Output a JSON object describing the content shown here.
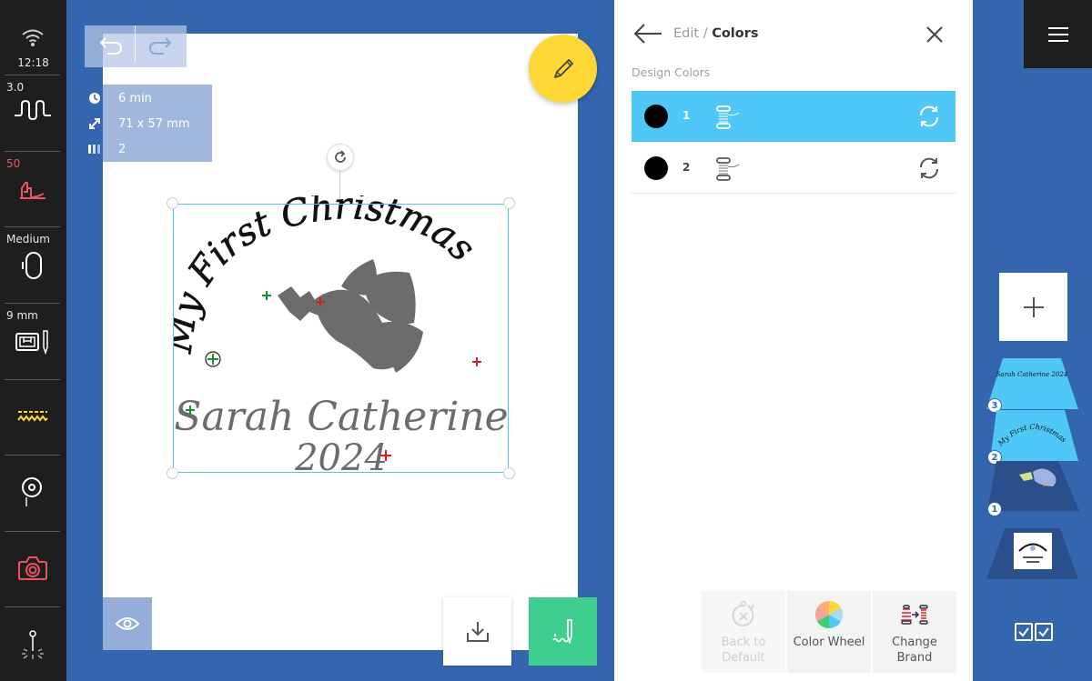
{
  "status": {
    "time": "12:18",
    "wifi_icon": "wifi-icon"
  },
  "leftbar": {
    "stitch_length": "3.0",
    "presser_foot_pressure": "50",
    "hoop_size": "Medium",
    "needle_size": "9 mm"
  },
  "canvas": {
    "info": {
      "time": "6 min",
      "size": "71 x 57 mm",
      "colors": "2"
    },
    "design": {
      "line1": "My First Christmas",
      "line2": "Sarah Catherine",
      "line3": "2024"
    }
  },
  "panel": {
    "breadcrumb_parent": "Edit / ",
    "breadcrumb_current": "Colors",
    "section_label": "Design Colors",
    "colors": [
      {
        "number": "1",
        "swatch": "#000000",
        "selected": true
      },
      {
        "number": "2",
        "swatch": "#000000",
        "selected": false
      }
    ],
    "actions": [
      {
        "label": "Back to Default",
        "enabled": false
      },
      {
        "label": "Color Wheel",
        "enabled": true
      },
      {
        "label": "Change Brand",
        "enabled": true
      }
    ]
  },
  "layers": [
    {
      "number": "3",
      "preview_text": "Sarah Catherine 2024",
      "selected": true
    },
    {
      "number": "2",
      "preview_text": "My First Christmas",
      "selected": true
    },
    {
      "number": "1",
      "preview_text": "dove",
      "selected": false
    }
  ],
  "colors": {
    "accent": "#4fc8f8",
    "background": "#3466b0",
    "toolbar": "#1e1e1e",
    "edit_fab": "#fdd835",
    "stitch_button": "#3ecf8e",
    "alert": "#e85560"
  }
}
